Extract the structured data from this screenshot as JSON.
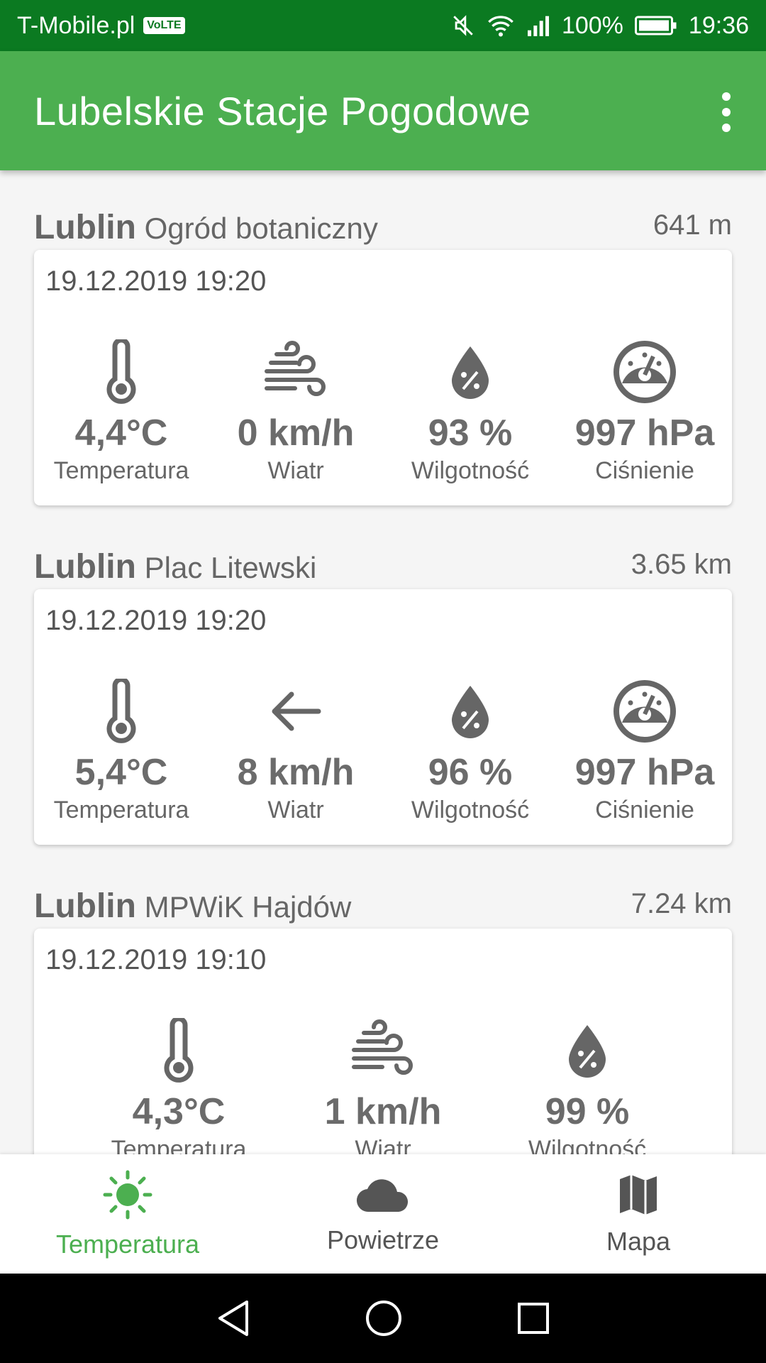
{
  "status_bar": {
    "carrier": "T-Mobile.pl",
    "volte": "VoLTE",
    "battery": "100%",
    "time": "19:36"
  },
  "app_bar": {
    "title": "Lubelskie Stacje Pogodowe",
    "menu_icon": "more-vert-icon"
  },
  "stations": [
    {
      "city": "Lublin",
      "name": "Ogród botaniczny",
      "distance": "641 m",
      "datetime": "19.12.2019 19:20",
      "metrics": [
        {
          "icon": "thermometer-icon",
          "value": "4,4°C",
          "label": "Temperatura"
        },
        {
          "icon": "wind-icon",
          "value": "0 km/h",
          "label": "Wiatr"
        },
        {
          "icon": "humidity-drop-icon",
          "value": "93 %",
          "label": "Wilgotność"
        },
        {
          "icon": "pressure-gauge-icon",
          "value": "997 hPa",
          "label": "Ciśnienie"
        }
      ]
    },
    {
      "city": "Lublin",
      "name": "Plac Litewski",
      "distance": "3.65 km",
      "datetime": "19.12.2019 19:20",
      "metrics": [
        {
          "icon": "thermometer-icon",
          "value": "5,4°C",
          "label": "Temperatura"
        },
        {
          "icon": "wind-direction-arrow-icon",
          "value": "8 km/h",
          "label": "Wiatr"
        },
        {
          "icon": "humidity-drop-icon",
          "value": "96 %",
          "label": "Wilgotność"
        },
        {
          "icon": "pressure-gauge-icon",
          "value": "997 hPa",
          "label": "Ciśnienie"
        }
      ]
    },
    {
      "city": "Lublin",
      "name": "MPWiK Hajdów",
      "distance": "7.24 km",
      "datetime": "19.12.2019 19:10",
      "metrics": [
        {
          "icon": "thermometer-icon",
          "value": "4,3°C",
          "label": "Temperatura"
        },
        {
          "icon": "wind-icon",
          "value": "1 km/h",
          "label": "Wiatr"
        },
        {
          "icon": "humidity-drop-icon",
          "value": "99 %",
          "label": "Wilgotność"
        }
      ]
    }
  ],
  "bottom_nav": {
    "items": [
      {
        "label": "Temperatura",
        "icon": "sun-icon",
        "active": true
      },
      {
        "label": "Powietrze",
        "icon": "cloud-icon",
        "active": false
      },
      {
        "label": "Mapa",
        "icon": "map-icon",
        "active": false
      }
    ]
  },
  "colors": {
    "status_bar": "#0b7a21",
    "app_bar": "#4caf50",
    "accent": "#4caf50",
    "icon_gray": "#666666"
  }
}
